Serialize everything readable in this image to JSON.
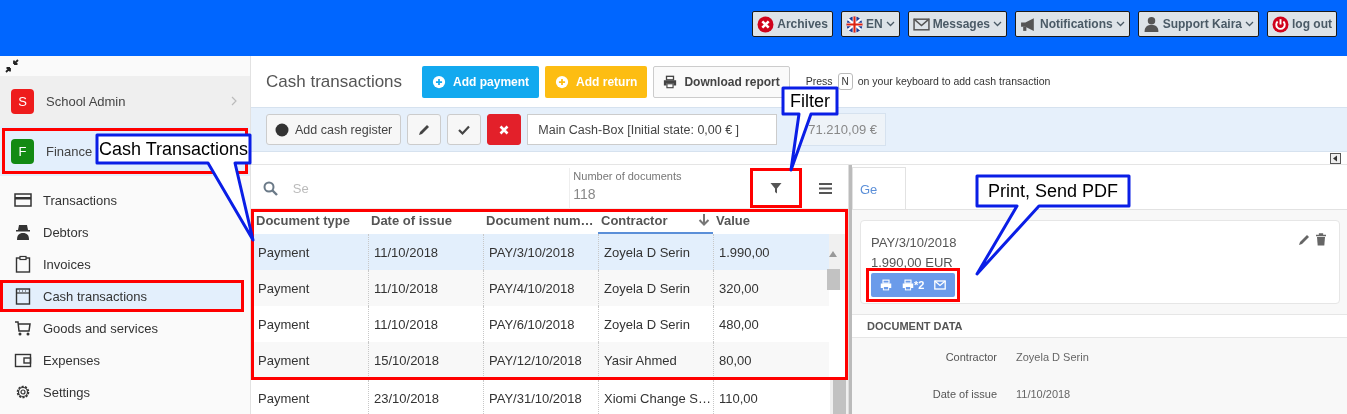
{
  "top_bar": {
    "buttons": [
      {
        "kind": "archives",
        "label": "Archives",
        "dropdown": false
      },
      {
        "kind": "language",
        "label": "EN",
        "dropdown": true
      },
      {
        "kind": "messages",
        "label": "Messages",
        "dropdown": true
      },
      {
        "kind": "notifications",
        "label": "Notifications",
        "dropdown": true
      },
      {
        "kind": "user",
        "label": "Support Kaira",
        "dropdown": true
      },
      {
        "kind": "logout",
        "label": "log out",
        "dropdown": false
      }
    ]
  },
  "sidebar": {
    "modules": [
      {
        "letter": "S",
        "label": "School Admin",
        "color": "#ee1c1c",
        "selected": false,
        "highlighted": false
      },
      {
        "letter": "F",
        "label": "Finance",
        "color": "#138a13",
        "selected": true,
        "highlighted": true
      }
    ],
    "items": [
      {
        "kind": "card",
        "label": "Transactions",
        "selected": false
      },
      {
        "kind": "spy",
        "label": "Debtors",
        "selected": false
      },
      {
        "kind": "clipboard",
        "label": "Invoices",
        "selected": false
      },
      {
        "kind": "register",
        "label": "Cash transactions",
        "selected": true,
        "highlighted": true
      },
      {
        "kind": "cart",
        "label": "Goods and services",
        "selected": false
      },
      {
        "kind": "wallet",
        "label": "Expenses",
        "selected": false
      },
      {
        "kind": "gear",
        "label": "Settings",
        "selected": false
      }
    ]
  },
  "page": {
    "title": "Cash transactions",
    "actions": [
      {
        "kind": "add_payment",
        "label": "Add payment"
      },
      {
        "kind": "add_return",
        "label": "Add return"
      },
      {
        "kind": "download",
        "label": "Download report"
      }
    ],
    "hint": {
      "before": "Press",
      "key": "N",
      "after": "on your keyboard to add cash transaction"
    }
  },
  "register_bar": {
    "add_label": "Add cash register",
    "register": "Main Cash-Box [Initial state: 0,00 € ]",
    "total": "71.210,09 €"
  },
  "table": {
    "search_placeholder": "Se",
    "filter_highlighted": true,
    "count_label": "Number of documents",
    "count": "118",
    "columns": [
      {
        "label": "Document type",
        "sorted": false
      },
      {
        "label": "Date of issue",
        "sorted": false
      },
      {
        "label": "Document num…",
        "sorted": false
      },
      {
        "label": "Contractor",
        "sorted": true
      },
      {
        "label": "Value",
        "sorted": false
      }
    ],
    "rows": [
      {
        "cells": [
          "Payment",
          "11/10/2018",
          "PAY/3/10/2018",
          "Zoyela D Serin",
          "1.990,00"
        ],
        "selected": true,
        "highlighted": true
      },
      {
        "cells": [
          "Payment",
          "11/10/2018",
          "PAY/4/10/2018",
          "Zoyela D Serin",
          "320,00"
        ],
        "selected": false,
        "highlighted": true
      },
      {
        "cells": [
          "Payment",
          "11/10/2018",
          "PAY/6/10/2018",
          "Zoyela D Serin",
          "480,00"
        ],
        "selected": false,
        "highlighted": true
      },
      {
        "cells": [
          "Payment",
          "15/10/2018",
          "PAY/12/10/2018",
          "Yasir Ahmed",
          "80,00"
        ],
        "selected": false,
        "highlighted": true
      },
      {
        "cells": [
          "Payment",
          "23/10/2018",
          "PAY/31/10/2018",
          "Xiomi Change S…",
          "110,00"
        ],
        "selected": false,
        "highlighted": false
      }
    ]
  },
  "detail": {
    "tabs": [
      {
        "label": "Ge",
        "selected": true
      }
    ],
    "number": "PAY/3/10/2018",
    "amount": "1.990,00 EUR",
    "copies": "*2",
    "actions_highlighted": true,
    "section": "DOCUMENT DATA",
    "fields": [
      {
        "label": "Contractor",
        "value": "Zoyela D Serin"
      },
      {
        "label": "Date of issue",
        "value": "11/10/2018"
      }
    ]
  },
  "annotations": [
    {
      "text": "Cash Transactions"
    },
    {
      "text": "Filter"
    },
    {
      "text": "Print, Send PDF"
    }
  ]
}
